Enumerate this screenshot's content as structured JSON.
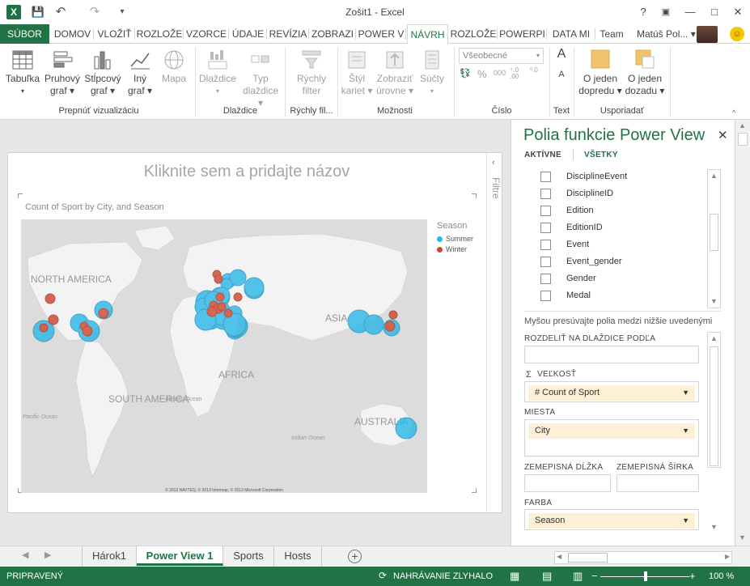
{
  "window": {
    "title": "Zošit1 - Excel",
    "help": "?",
    "minimize": "—",
    "restore": "□",
    "close": "✕"
  },
  "qat": {
    "save": "💾",
    "undo": "↶",
    "redo": "↷",
    "customize": "▾"
  },
  "tabs": {
    "file": "SÚBOR",
    "items": [
      "DOMOV",
      "VLOŽIŤ",
      "ROZLOŽE",
      "VZORCE",
      "ÚDAJE",
      "REVÍZIA",
      "ZOBRAZI",
      "POWER V",
      "NÁVRH",
      "ROZLOŽE",
      "POWERPI",
      "DATA MI",
      "Team"
    ],
    "active": "NÁVRH",
    "user": "Matúš Pol... ▾"
  },
  "ribbon": {
    "switch_visualization": {
      "label": "Prepnúť vizualizáciu",
      "table": [
        "Tabuľka",
        "▾"
      ],
      "bar": [
        "Pruhový",
        "graf ▾"
      ],
      "column": [
        "Stĺpcový",
        "graf ▾"
      ],
      "other": [
        "Iný",
        "graf ▾"
      ],
      "map": [
        "Mapa",
        ""
      ]
    },
    "tiles": {
      "label": "Dlaždice",
      "tiles": [
        "Dlaždice",
        "▾"
      ],
      "type": [
        "Typ",
        "dlaždice ▾"
      ]
    },
    "quick_filter": {
      "label": "Rýchly fil...",
      "button": [
        "Rýchly",
        "filter"
      ]
    },
    "options": {
      "label": "Možnosti",
      "card_style": [
        "Štýl",
        "kariet ▾"
      ],
      "show_levels": [
        "Zobraziť",
        "úrovne ▾"
      ],
      "totals": [
        "Súčty",
        "▾"
      ]
    },
    "number": {
      "label": "Číslo",
      "format": "Všeobecné",
      "format_arrow": "▾",
      "currency": "💱",
      "percent": "%",
      "thousands": "000",
      "inc_dec": "⁺.0 .00",
      "dec_dec": "⁰.0"
    },
    "text": {
      "label": "Text",
      "grow": "A",
      "shrink": "A"
    },
    "arrange": {
      "label": "Usporiadať",
      "forward": [
        "O jeden",
        "dopredu ▾"
      ],
      "backward": [
        "O jeden",
        "dozadu ▾"
      ]
    }
  },
  "canvas": {
    "title_placeholder": "Kliknite sem a pridajte názov",
    "filters": "Filtre",
    "filters_chevron": "‹",
    "map_caption": "Count of Sport by City, and Season",
    "copyright": "© 2013 NAVTEQ, © 2013 Intermap, © 2013 Microsoft Corporation",
    "map_labels": {
      "north_america": "NORTH AMERICA",
      "south_america": "SOUTH AMERICA",
      "africa": "AFRICA",
      "asia": "ASIA",
      "australia": "AUSTRALIA",
      "atlantic": "Atlantic Ocean",
      "pacific": "Pacific Ocean",
      "indian": "Indian Ocean"
    },
    "legend": {
      "title": "Season",
      "items": [
        {
          "name": "Summer",
          "color": "#29b6e8"
        },
        {
          "name": "Winter",
          "color": "#d0442c"
        }
      ]
    }
  },
  "pane": {
    "title": "Polia funkcie Power View",
    "close": "✕",
    "tab_active": "AKTÍVNE",
    "tab_all": "VŠETKY",
    "fields": [
      "DisciplineEvent",
      "DisciplineID",
      "Edition",
      "EditionID",
      "Event",
      "Event_gender",
      "Gender",
      "Medal"
    ],
    "hint": "Myšou presúvajte polia medzi nižšie uvedenými",
    "sections": {
      "tile_by": "ROZDELIŤ NA DLAŽDICE PODĽA",
      "size": "VEĽKOSŤ",
      "size_icon": "Σ",
      "size_field": "# Count of Sport",
      "locations": "MIESTA",
      "locations_field": "City",
      "longitude": "ZEMEPISNÁ DĹŽKA",
      "latitude": "ZEMEPISNÁ ŠÍRKA",
      "color": "FARBA",
      "color_field": "Season"
    },
    "pill_arrow": "▼",
    "scroll_up": "▲",
    "scroll_down": "▼"
  },
  "sheets": {
    "items": [
      "Hárok1",
      "Power View 1",
      "Sports",
      "Hosts"
    ],
    "active": "Power View 1",
    "add": "+",
    "prev": "◀",
    "next": "▶"
  },
  "status": {
    "ready": "PRIPRAVENÝ",
    "upload_failed": "NAHRÁVANIE ZLYHALO",
    "zoom": "100 %",
    "zoom_minus": "−",
    "zoom_plus": "+"
  },
  "colors": {
    "accent": "#217346",
    "summer": "#29b6e8",
    "winter": "#d0442c"
  }
}
